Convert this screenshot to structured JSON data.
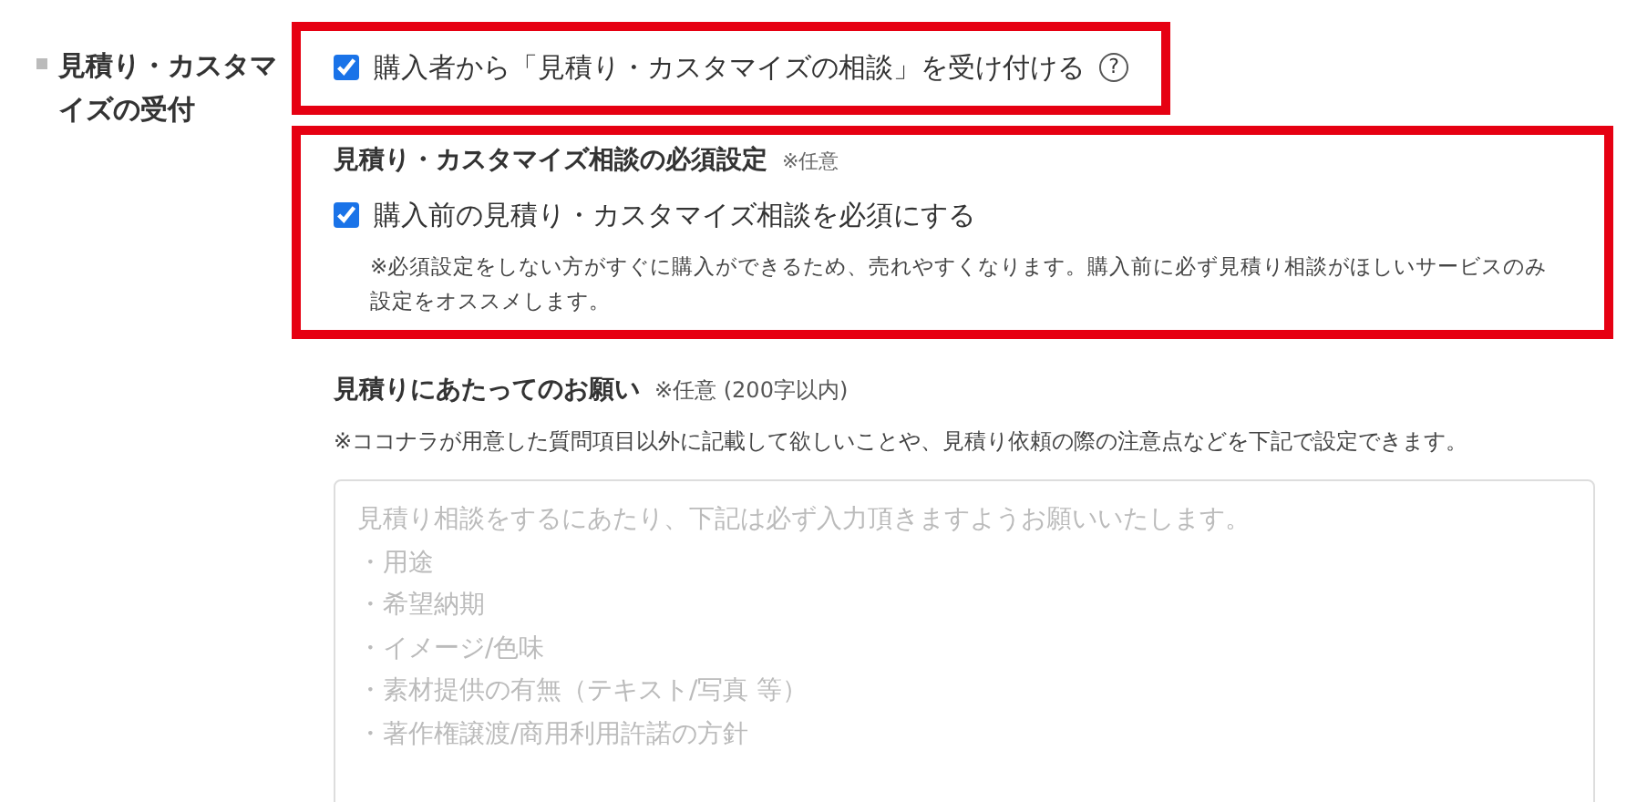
{
  "field_label": "見積り・カスタマイズの受付",
  "accept": {
    "label": "購入者から「見積り・カスタマイズの相談」を受け付ける",
    "checked": true,
    "highlighted": true,
    "help_icon": "?"
  },
  "required_setting": {
    "title": "見積り・カスタマイズ相談の必須設定",
    "optional": "※任意",
    "highlighted": true,
    "checkbox": {
      "label": "購入前の見積り・カスタマイズ相談を必須にする",
      "checked": true
    },
    "note": "※必須設定をしない方がすぐに購入ができるため、売れやすくなります。購入前に必ず見積り相談がほしいサービスのみ設定をオススメします。"
  },
  "request": {
    "title": "見積りにあたってのお願い",
    "optional": "※任意 (200字以内)",
    "note": "※ココナラが用意した質問項目以外に記載して欲しいことや、見積り依頼の際の注意点などを下記で設定できます。",
    "placeholder_lines": [
      "見積り相談をするにあたり、下記は必ず入力頂きますようお願いいたします。",
      "・用途",
      "・希望納期",
      "・イメージ/色味",
      "・素材提供の有無（テキスト/写真 等）",
      "・著作権譲渡/商用利用許諾の方針"
    ]
  }
}
